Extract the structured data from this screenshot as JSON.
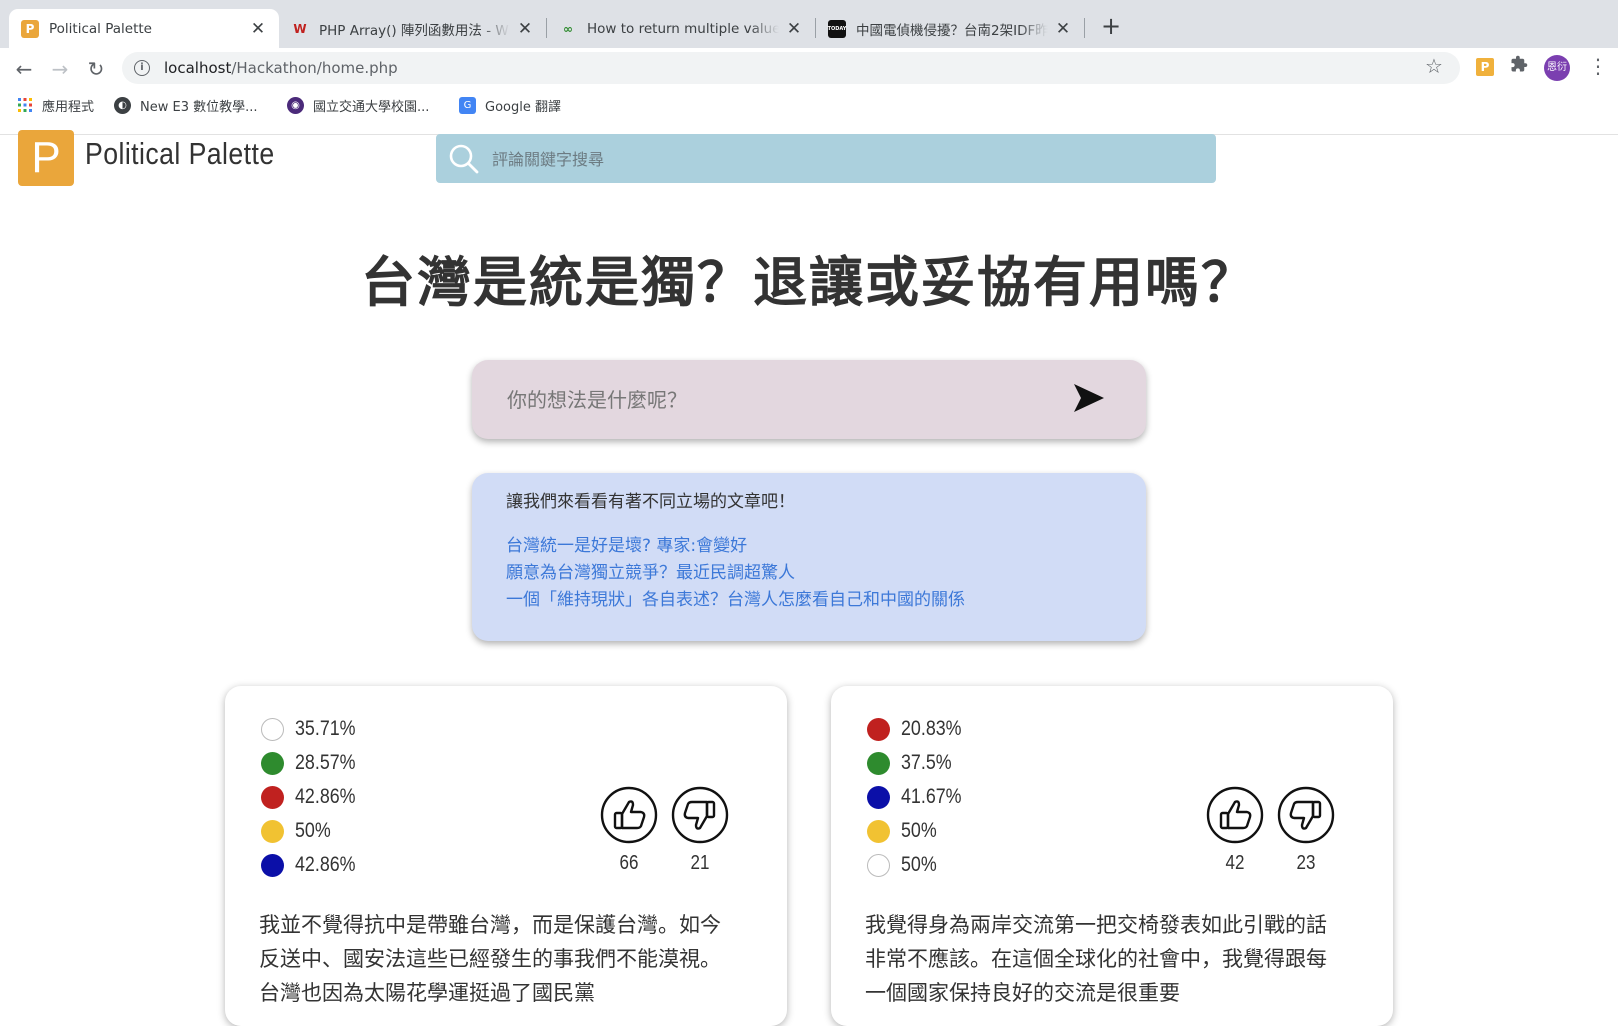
{
  "browser": {
    "tabs": [
      {
        "favicon_text": "P",
        "title": "Political Palette",
        "active": true
      },
      {
        "favicon_text": "W",
        "title": "PHP Array() 陣列函數用法 - Wibibi"
      },
      {
        "favicon_text": "∞",
        "title": "How to return multiple values from"
      },
      {
        "favicon_text": "TODAY",
        "title": "中國電偵機侵擾？台南2架IDF昨"
      }
    ],
    "url_host": "localhost",
    "url_path": "/Hackathon/home.php",
    "profile_initials": "恩衍",
    "extension_label": "P",
    "bookmarks": [
      "應用程式",
      "New E3 數位教學...",
      "國立交通大學校園...",
      "Google 翻譯"
    ]
  },
  "site": {
    "logo_letter": "P",
    "name": "Political Palette",
    "search_placeholder": "評論關鍵字搜尋"
  },
  "topic": {
    "title": "台灣是統是獨？退讓或妥協有用嗎？"
  },
  "opinion_box": {
    "placeholder": "你的想法是什麼呢？"
  },
  "articles": {
    "intro": "讓我們來看看有著不同立場的文章吧！",
    "links": [
      "台灣統一是好是壞? 專家:會變好",
      "願意為台灣獨立競爭？最近民調超驚人",
      "一個「維持現狀」各自表述？台灣人怎麼看自己和中國的關係"
    ]
  },
  "colors": {
    "accent_orange": "#eaa63b",
    "search_bg": "#abd0dd",
    "opinion_bg": "#e3d7df",
    "articles_bg": "#d1dcf6",
    "link": "#3c78d8",
    "white": "#ffffff",
    "green": "#2e8b2e",
    "red": "#c0211f",
    "yellow": "#f1c232",
    "blue": "#0b0fa8"
  },
  "comments": [
    {
      "stats": [
        {
          "color": "white",
          "percent": "35.71%"
        },
        {
          "color": "green",
          "percent": "28.57%"
        },
        {
          "color": "red",
          "percent": "42.86%"
        },
        {
          "color": "yellow",
          "percent": "50%"
        },
        {
          "color": "blue",
          "percent": "42.86%"
        }
      ],
      "likes": "66",
      "dislikes": "21",
      "text": "我並不覺得抗中是帶雖台灣，而是保護台灣。如今反送中、國安法這些已經發生的事我們不能漠視。台灣也因為太陽花學運挺過了國民黨"
    },
    {
      "stats": [
        {
          "color": "red",
          "percent": "20.83%"
        },
        {
          "color": "green",
          "percent": "37.5%"
        },
        {
          "color": "blue",
          "percent": "41.67%"
        },
        {
          "color": "yellow",
          "percent": "50%"
        },
        {
          "color": "white",
          "percent": "50%"
        }
      ],
      "likes": "42",
      "dislikes": "23",
      "text": "我覺得身為兩岸交流第一把交椅發表如此引戰的話非常不應該。在這個全球化的社會中，我覺得跟每一個國家保持良好的交流是很重要"
    }
  ]
}
